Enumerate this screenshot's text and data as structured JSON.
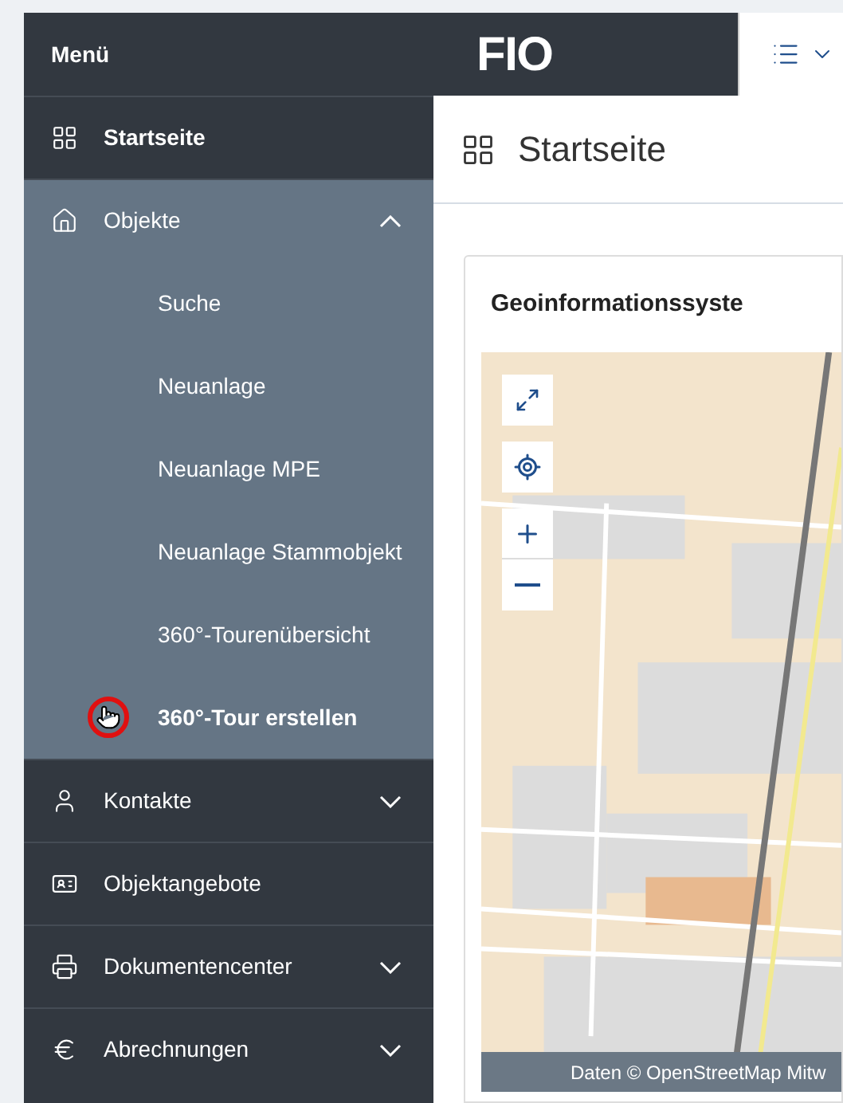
{
  "sidebar": {
    "title": "Menü",
    "items": [
      {
        "kind": "link",
        "label": "Startseite",
        "selected": true
      },
      {
        "kind": "group",
        "label": "Objekte",
        "expanded": true,
        "children": [
          {
            "label": "Suche",
            "selected": false
          },
          {
            "label": "Neuanlage",
            "selected": false
          },
          {
            "label": "Neuanlage MPE",
            "selected": false
          },
          {
            "label": "Neuanlage Stammobjekt",
            "selected": false
          },
          {
            "label": "360°-Tourenübersicht",
            "selected": false
          },
          {
            "label": "360°-Tour erstellen",
            "selected": true
          }
        ]
      },
      {
        "kind": "group",
        "label": "Kontakte",
        "expanded": false
      },
      {
        "kind": "link",
        "label": "Objektangebote",
        "selected": false
      },
      {
        "kind": "group",
        "label": "Dokumentencenter",
        "expanded": false
      },
      {
        "kind": "group",
        "label": "Abrechnungen",
        "expanded": false
      }
    ]
  },
  "header": {
    "logo": "FIO"
  },
  "page": {
    "title": "Startseite"
  },
  "card": {
    "title": "Geoinformationssyste",
    "map": {
      "attribution": "Daten © OpenStreetMap Mitw"
    }
  }
}
